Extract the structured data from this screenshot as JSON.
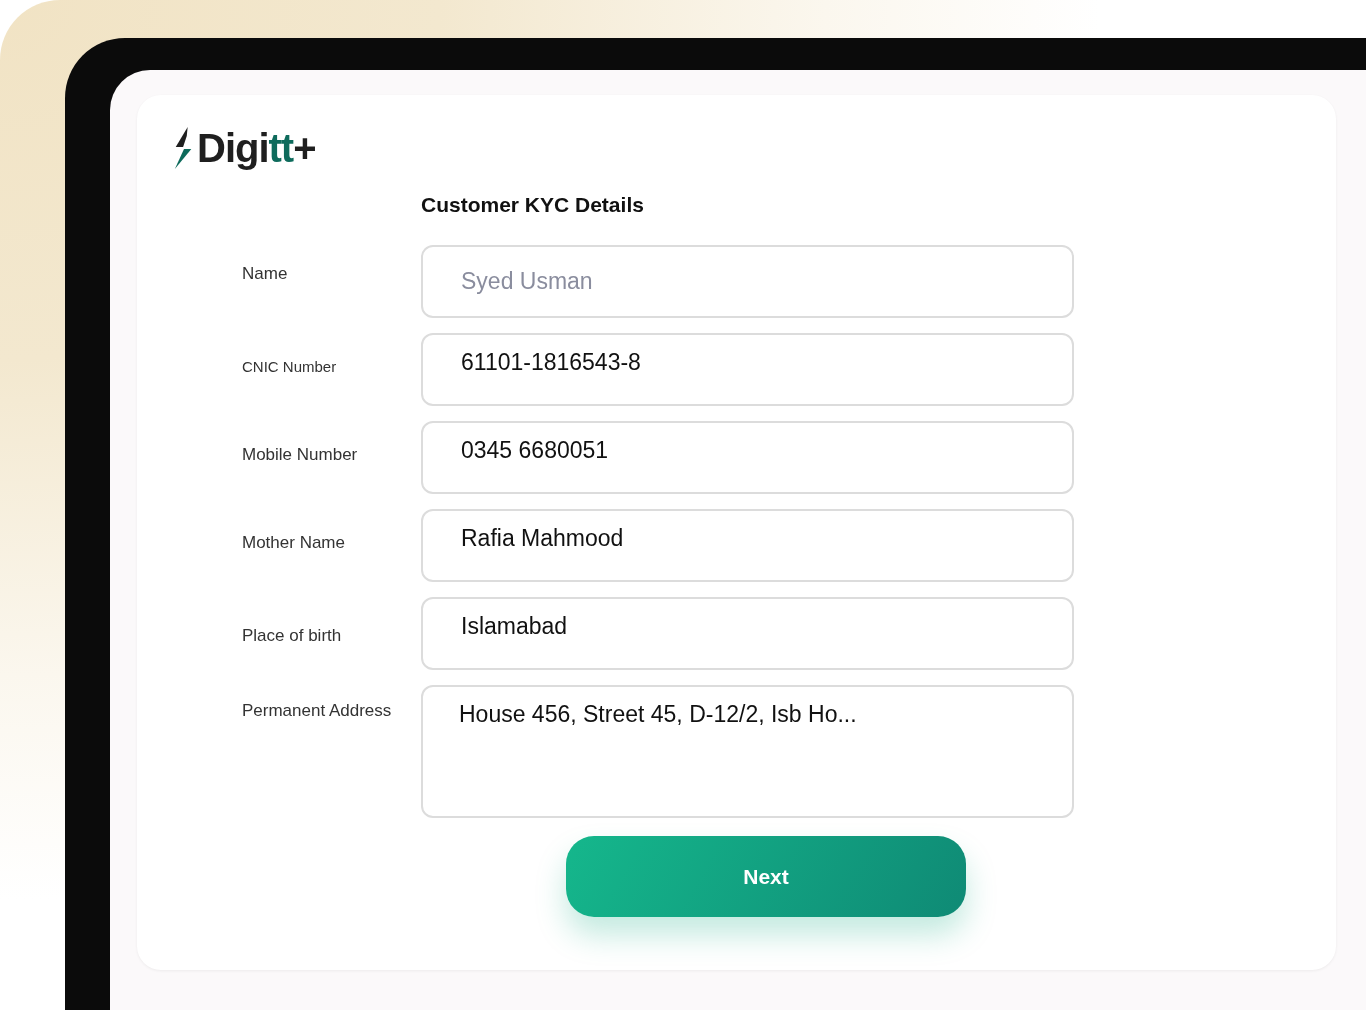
{
  "logo": {
    "parts": [
      {
        "text": "Digi",
        "color": "#1f1f1f"
      },
      {
        "text": "tt",
        "color": "#0e6b5c"
      },
      {
        "text": "+",
        "color": "#1f1f1f"
      }
    ]
  },
  "title": "Customer KYC Details",
  "fields": [
    {
      "label": "Name",
      "kind": "input",
      "placeholder": "Syed Usman"
    },
    {
      "label": "CNIC Number",
      "kind": "input",
      "value": "61101-1816543-8"
    },
    {
      "label": "Mobile Number",
      "kind": "input",
      "value": "0345 6680051"
    },
    {
      "label": "Mother Name",
      "kind": "input",
      "value": "Rafia Mahmood"
    },
    {
      "label": "Place of birth",
      "kind": "input",
      "value": "Islamabad"
    },
    {
      "label": "Permanent Address",
      "kind": "textarea",
      "value": "House 456, Street 45, D-12/2, Isb Ho..."
    }
  ],
  "button": "Next"
}
